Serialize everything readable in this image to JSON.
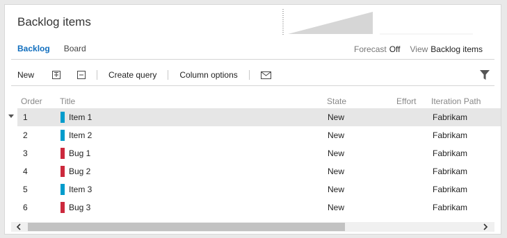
{
  "header": {
    "title": "Backlog items"
  },
  "tabs": [
    {
      "label": "Backlog",
      "active": true
    },
    {
      "label": "Board",
      "active": false
    }
  ],
  "options": {
    "forecast_label": "Forecast",
    "forecast_value": "Off",
    "view_label": "View",
    "view_value": "Backlog items"
  },
  "toolbar": {
    "new_label": "New",
    "create_query_label": "Create query",
    "column_options_label": "Column options",
    "icons": [
      "expand-all-icon",
      "collapse-all-icon",
      "mail-icon",
      "filter-icon"
    ]
  },
  "columns": {
    "order": "Order",
    "title": "Title",
    "state": "State",
    "effort": "Effort",
    "iteration": "Iteration Path"
  },
  "colors": {
    "item": "#009ccc",
    "bug": "#cc293d",
    "accent": "#106ebe",
    "selected_row": "#e6e6e6"
  },
  "rows": [
    {
      "order": "1",
      "title": "Item 1",
      "type": "item",
      "state": "New",
      "effort": "",
      "iteration": "Fabrikam"
    },
    {
      "order": "2",
      "title": "Item 2",
      "type": "item",
      "state": "New",
      "effort": "",
      "iteration": "Fabrikam"
    },
    {
      "order": "3",
      "title": "Bug 1",
      "type": "bug",
      "state": "New",
      "effort": "",
      "iteration": "Fabrikam"
    },
    {
      "order": "4",
      "title": "Bug 2",
      "type": "bug",
      "state": "New",
      "effort": "",
      "iteration": "Fabrikam"
    },
    {
      "order": "5",
      "title": "Item 3",
      "type": "item",
      "state": "New",
      "effort": "",
      "iteration": "Fabrikam"
    },
    {
      "order": "6",
      "title": "Bug 3",
      "type": "bug",
      "state": "New",
      "effort": "",
      "iteration": "Fabrikam"
    }
  ]
}
